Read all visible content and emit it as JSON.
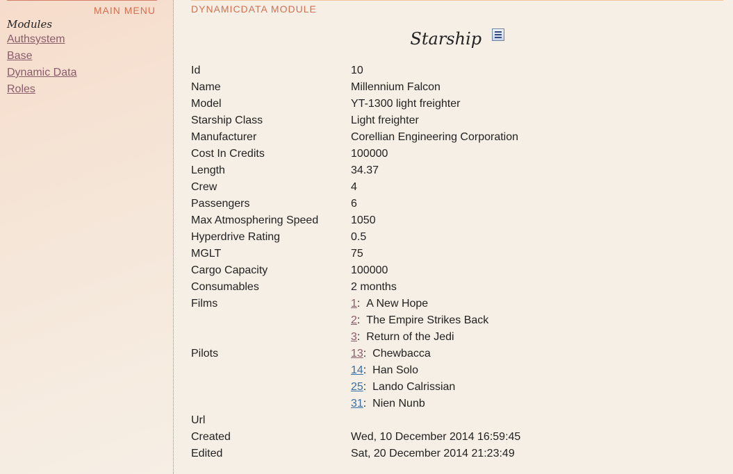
{
  "sidebar": {
    "menu_title": "MAIN MENU",
    "modules_heading": "Modules",
    "items": [
      {
        "label": "Authsystem"
      },
      {
        "label": "Base"
      },
      {
        "label": "Dynamic Data"
      },
      {
        "label": "Roles"
      }
    ]
  },
  "main": {
    "module_title": "DYNAMICDATA MODULE",
    "record_title": "Starship",
    "list_icon": "list-icon"
  },
  "fields": {
    "id": {
      "label": "Id",
      "value": "10"
    },
    "name": {
      "label": "Name",
      "value": "Millennium Falcon"
    },
    "model": {
      "label": "Model",
      "value": "YT-1300 light freighter"
    },
    "starship_class": {
      "label": "Starship Class",
      "value": "Light freighter"
    },
    "manufacturer": {
      "label": "Manufacturer",
      "value": "Corellian Engineering Corporation"
    },
    "cost": {
      "label": "Cost In Credits",
      "value": "100000"
    },
    "length": {
      "label": "Length",
      "value": "34.37"
    },
    "crew": {
      "label": "Crew",
      "value": "4"
    },
    "passengers": {
      "label": "Passengers",
      "value": "6"
    },
    "max_speed": {
      "label": "Max Atmosphering Speed",
      "value": "1050"
    },
    "hyperdrive": {
      "label": "Hyperdrive Rating",
      "value": "0.5"
    },
    "mglt": {
      "label": "MGLT",
      "value": "75"
    },
    "cargo": {
      "label": "Cargo Capacity",
      "value": "100000"
    },
    "consumables": {
      "label": "Consumables",
      "value": "2 months"
    },
    "films": {
      "label": "Films",
      "items": [
        {
          "id": "1",
          "sep": ":",
          "title": "A New Hope"
        },
        {
          "id": "2",
          "sep": ":",
          "title": "The Empire Strikes Back"
        },
        {
          "id": "3",
          "sep": ":",
          "title": "Return of the Jedi"
        }
      ]
    },
    "pilots": {
      "label": "Pilots",
      "items": [
        {
          "id": "13",
          "sep": ":",
          "name": "Chewbacca"
        },
        {
          "id": "14",
          "sep": ":",
          "name": "Han Solo"
        },
        {
          "id": "25",
          "sep": ":",
          "name": "Lando Calrissian"
        },
        {
          "id": "31",
          "sep": ":",
          "name": "Nien Nunb"
        }
      ]
    },
    "url": {
      "label": "Url",
      "value": ""
    },
    "created": {
      "label": "Created",
      "value": "Wed, 10 December 2014 16:59:45"
    },
    "edited": {
      "label": "Edited",
      "value": "Sat, 20 December 2014 21:23:49"
    }
  },
  "colors": {
    "accent": "#d2704f",
    "link_visited": "#8b5b6a",
    "link": "#3a6fa5",
    "background": "#f6efe5"
  }
}
